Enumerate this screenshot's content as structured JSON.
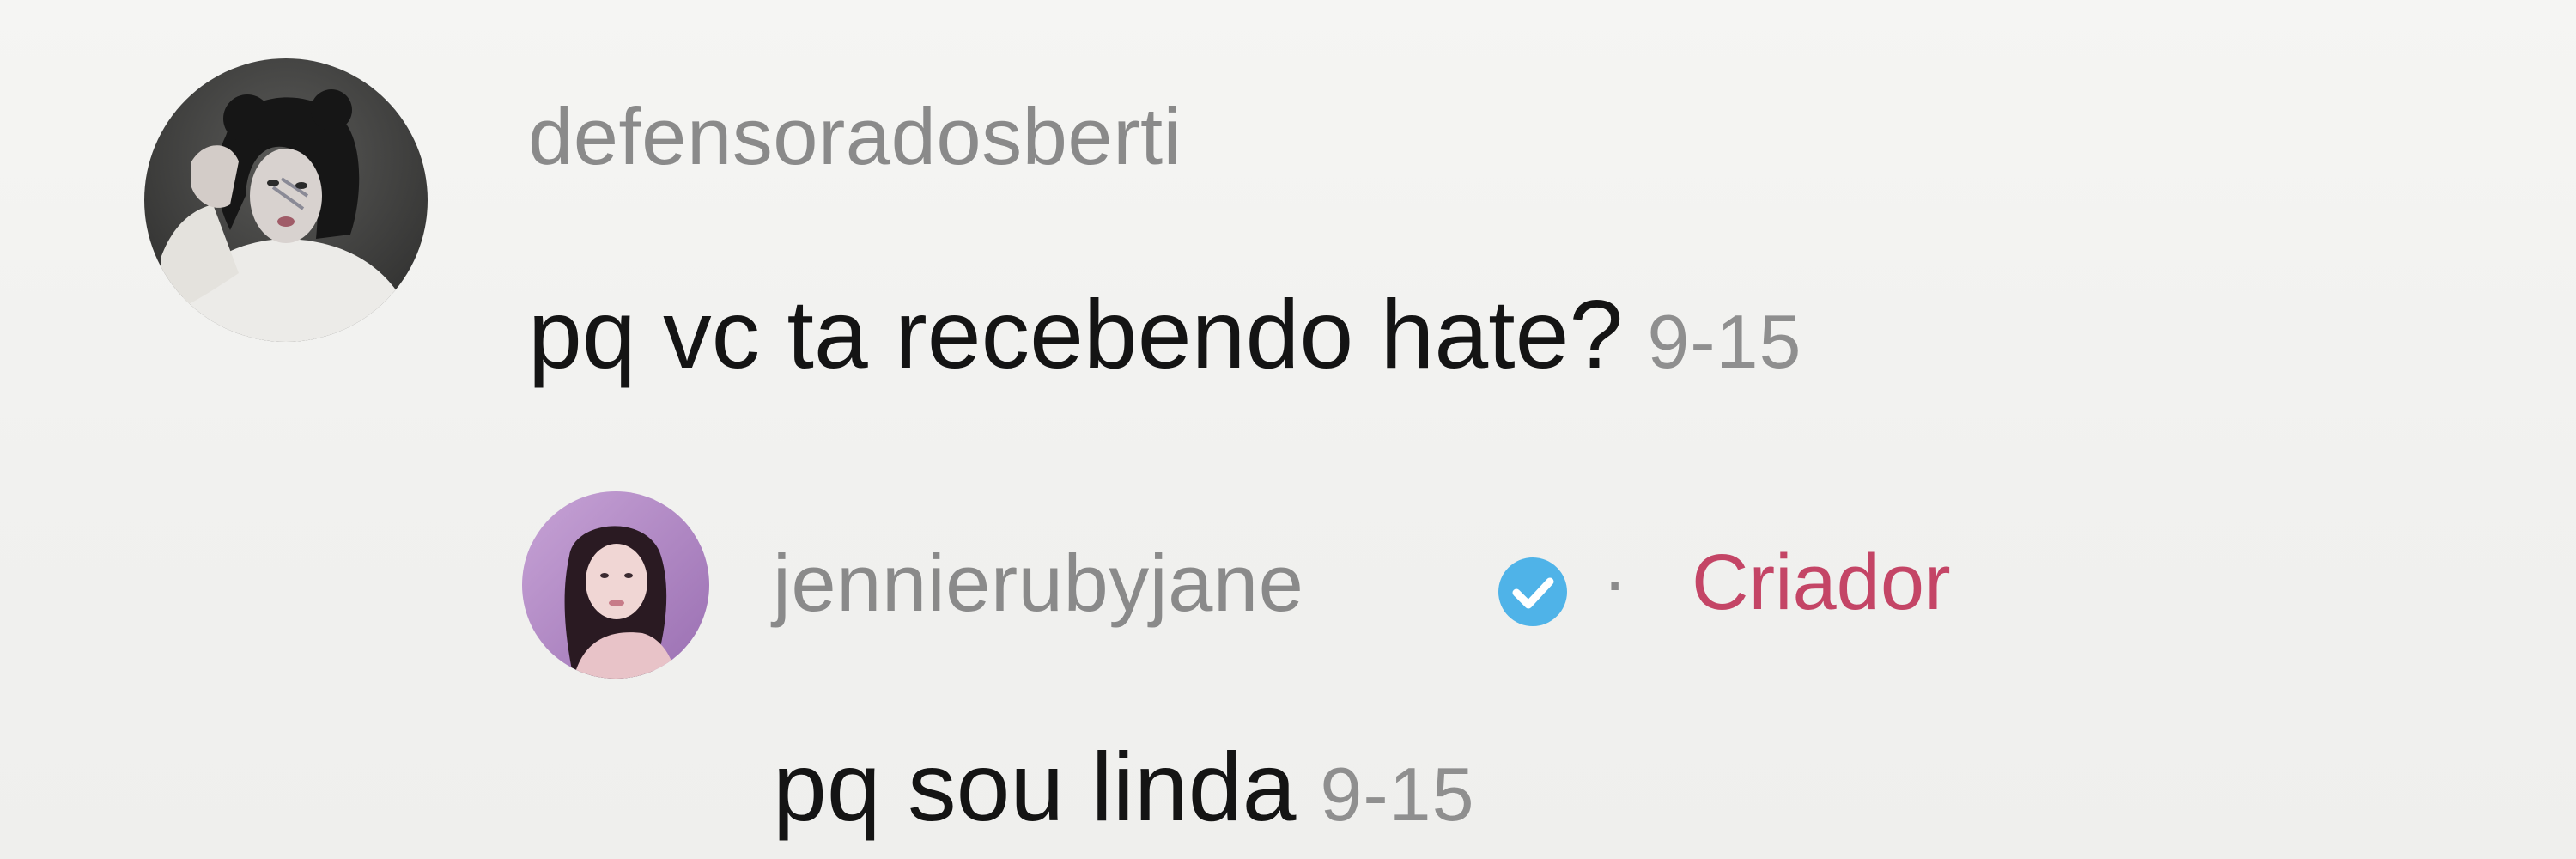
{
  "comment": {
    "username": "defensoradosberti",
    "text": "pq vc ta recebendo hate?",
    "timestamp": "9-15"
  },
  "reply": {
    "username": "jennierubyjane",
    "separator": "·",
    "badge": "Criador",
    "text": "pq sou linda",
    "timestamp": "9-15"
  },
  "icons": {
    "verified": "verified-check-icon"
  },
  "colors": {
    "username": "#8a8a8a",
    "comment_text": "#141414",
    "timestamp": "#8f8f8f",
    "creator_badge": "#c44566",
    "verified_badge": "#4fb3e8",
    "background": "#f3f3f1"
  }
}
